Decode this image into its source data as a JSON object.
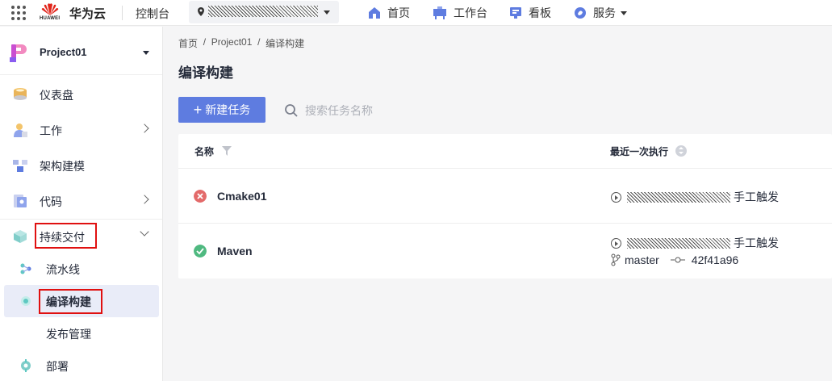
{
  "topbar": {
    "brand": "华为云",
    "logo_text": "HUAWEI",
    "console": "控制台",
    "nav": [
      {
        "label": "首页",
        "icon": "home-icon"
      },
      {
        "label": "工作台",
        "icon": "workbench-icon"
      },
      {
        "label": "看板",
        "icon": "board-icon"
      },
      {
        "label": "服务",
        "icon": "services-icon"
      }
    ]
  },
  "sidebar": {
    "project": "Project01",
    "items": [
      {
        "label": "仪表盘"
      },
      {
        "label": "工作"
      },
      {
        "label": "架构建模"
      },
      {
        "label": "代码"
      },
      {
        "label": "持续交付"
      }
    ],
    "subitems": [
      {
        "label": "流水线"
      },
      {
        "label": "编译构建"
      },
      {
        "label": "发布管理"
      }
    ],
    "deploy": "部署"
  },
  "main": {
    "breadcrumb": [
      "首页",
      "Project01",
      "编译构建"
    ],
    "breadcrumb_sep": "/",
    "title": "编译构建",
    "new_button": "新建任务",
    "search_placeholder": "搜索任务名称",
    "columns": [
      "名称",
      "最近一次执行"
    ],
    "rows": [
      {
        "name": "Cmake01",
        "status": "failed",
        "trigger": "手工触发"
      },
      {
        "name": "Maven",
        "status": "success",
        "trigger": "手工触发",
        "branch": "master",
        "commit": "42f41a96"
      }
    ]
  },
  "colors": {
    "primary": "#5e7ce0",
    "fail": "#e36a6a",
    "success": "#4fb980",
    "highlight_box": "#e01010"
  }
}
